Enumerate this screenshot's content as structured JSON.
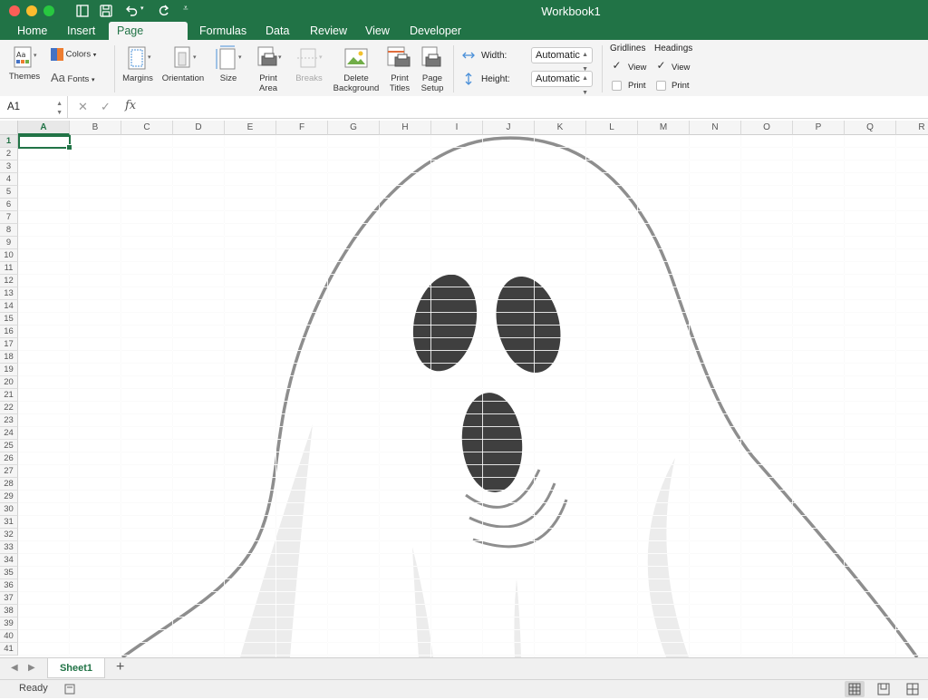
{
  "window": {
    "title": "Workbook1"
  },
  "tabs": [
    "Home",
    "Insert",
    "Page Layout",
    "Formulas",
    "Data",
    "Review",
    "View",
    "Developer"
  ],
  "active_tab": "Page Layout",
  "ribbon": {
    "themes": "Themes",
    "colors": "Colors",
    "fonts": "Fonts",
    "fonts_glyph": "Aa",
    "margins": "Margins",
    "orientation": "Orientation",
    "size": "Size",
    "print_area": [
      "Print",
      "Area"
    ],
    "breaks": "Breaks",
    "delete_background": [
      "Delete",
      "Background"
    ],
    "print_titles": [
      "Print",
      "Titles"
    ],
    "page_setup": [
      "Page",
      "Setup"
    ],
    "width_label": "Width:",
    "width_value": "Automatic",
    "height_label": "Height:",
    "height_value": "Automatic",
    "gridlines": {
      "title": "Gridlines",
      "view_label": "View",
      "view_checked": true,
      "print_label": "Print",
      "print_checked": false
    },
    "headings": {
      "title": "Headings",
      "view_label": "View",
      "view_checked": true,
      "print_label": "Print",
      "print_checked": false
    }
  },
  "formula_bar": {
    "name_box": "A1",
    "fx": "fx",
    "formula": ""
  },
  "columns": [
    "A",
    "B",
    "C",
    "D",
    "E",
    "F",
    "G",
    "H",
    "I",
    "J",
    "K",
    "L",
    "M",
    "N",
    "O",
    "P",
    "Q",
    "R"
  ],
  "rows": [
    "1",
    "2",
    "3",
    "4",
    "5",
    "6",
    "7",
    "8",
    "9",
    "10",
    "11",
    "12",
    "13",
    "14",
    "15",
    "16",
    "17",
    "18",
    "19",
    "20",
    "21",
    "22",
    "23",
    "24",
    "25",
    "26",
    "27",
    "28",
    "29",
    "30",
    "31",
    "32",
    "33",
    "34",
    "35",
    "36",
    "37",
    "38",
    "39",
    "40",
    "41"
  ],
  "selected_cell": "A1",
  "sheets": [
    "Sheet1"
  ],
  "add_sheet": "+",
  "status": {
    "text": "Ready"
  },
  "colors": {
    "accent": "#217346",
    "ghost_outline": "#8e8e8e",
    "ghost_features": "#3f3f3f"
  },
  "icons": [
    "undo-icon",
    "redo-icon",
    "save-icon",
    "sidebar-icon"
  ]
}
